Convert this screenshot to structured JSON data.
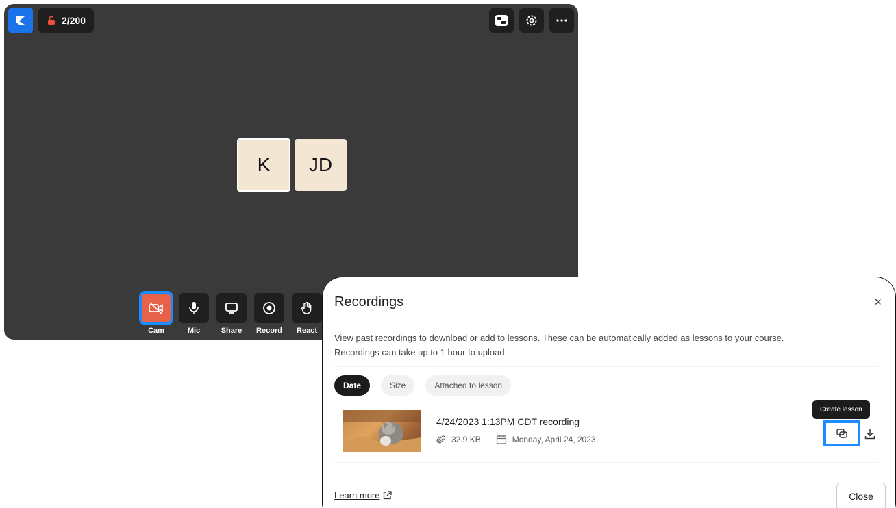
{
  "meeting": {
    "participant_count": "2/200",
    "participants": [
      {
        "initials": "K",
        "active": true
      },
      {
        "initials": "JD",
        "active": false
      }
    ],
    "controls": [
      {
        "label": "Cam",
        "icon": "camera-off-icon"
      },
      {
        "label": "Mic",
        "icon": "mic-icon"
      },
      {
        "label": "Share",
        "icon": "screen-share-icon"
      },
      {
        "label": "Record",
        "icon": "record-icon"
      },
      {
        "label": "React",
        "icon": "hand-icon"
      }
    ]
  },
  "recordings": {
    "title": "Recordings",
    "close_glyph": "×",
    "description_line1": "View past recordings to download or add to lessons. These can be automatically added as lessons to your course.",
    "description_line2": "Recordings can take up to 1 hour to upload.",
    "filters": [
      {
        "label": "Date",
        "active": true
      },
      {
        "label": "Size",
        "active": false
      },
      {
        "label": "Attached to lesson",
        "active": false
      }
    ],
    "items": [
      {
        "title": "4/24/2023 1:13PM CDT recording",
        "size": "32.9 KB",
        "date": "Monday, April 24, 2023"
      }
    ],
    "tooltip": "Create lesson",
    "learn_more": "Learn more",
    "close_label": "Close"
  },
  "colors": {
    "accent": "#1a8cff",
    "cam_off": "#e8624a",
    "tile": "#f3e6d3",
    "meeting_bg": "#3a3a3a"
  }
}
